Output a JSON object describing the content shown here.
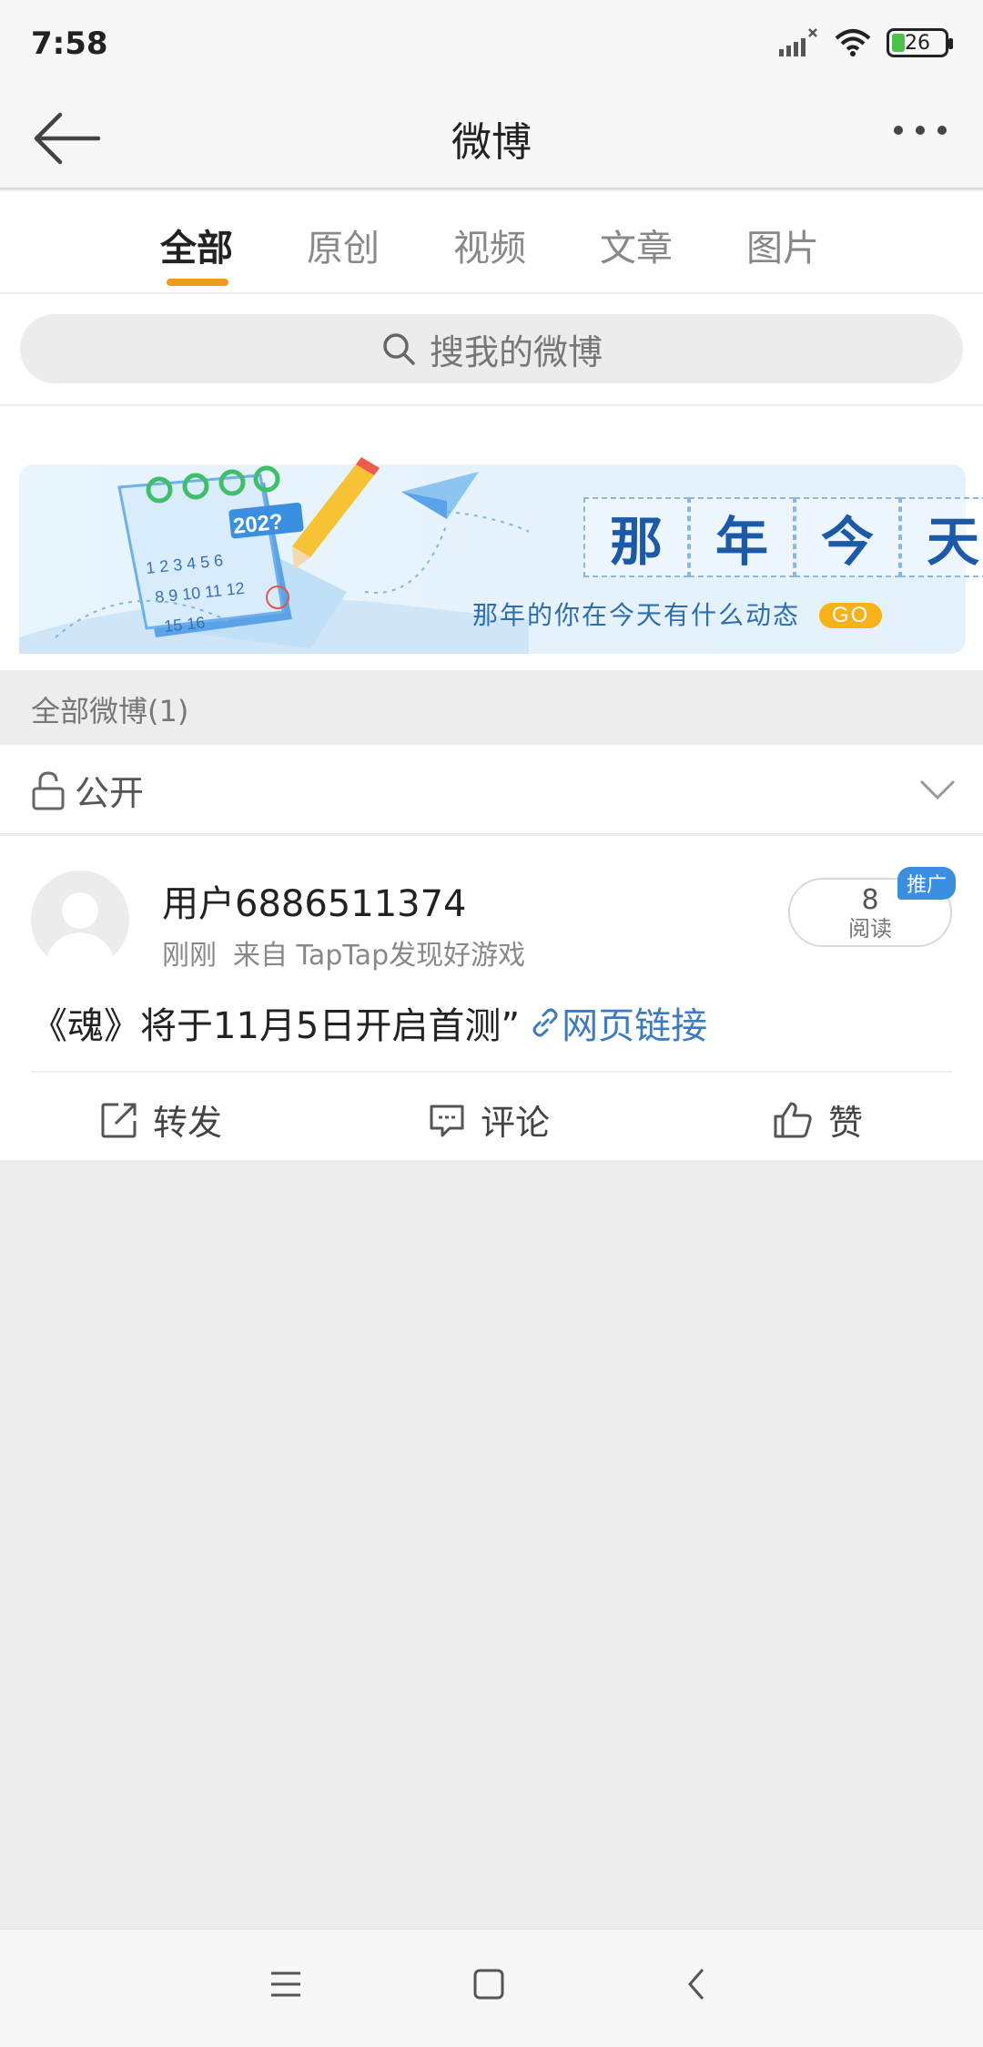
{
  "status_bar": {
    "time": "7:58",
    "battery": "26"
  },
  "nav": {
    "title": "微博"
  },
  "tabs": [
    {
      "label": "全部",
      "active": true
    },
    {
      "label": "原创",
      "active": false
    },
    {
      "label": "视频",
      "active": false
    },
    {
      "label": "文章",
      "active": false
    },
    {
      "label": "图片",
      "active": false
    }
  ],
  "search": {
    "placeholder": "搜我的微博"
  },
  "banner": {
    "calendar_year": "202?",
    "title_chars": [
      "那",
      "年",
      "今",
      "天"
    ],
    "subtitle": "那年的你在今天有什么动态",
    "go": "GO"
  },
  "section": {
    "label": "全部微博(1)"
  },
  "filter": {
    "label": "公开"
  },
  "post": {
    "username": "用户6886511374",
    "time": "刚刚",
    "source": "来自 TapTap发现好游戏",
    "read_count": "8",
    "read_label": "阅读",
    "badge": "推广",
    "text": "《魂》将于11月5日开启首测”",
    "link_text": "网页链接",
    "actions": {
      "repost": "转发",
      "comment": "评论",
      "like": "赞"
    }
  },
  "colors": {
    "accent": "#f09a1a",
    "link": "#3d7bbf",
    "badge": "#3b8fe0"
  }
}
